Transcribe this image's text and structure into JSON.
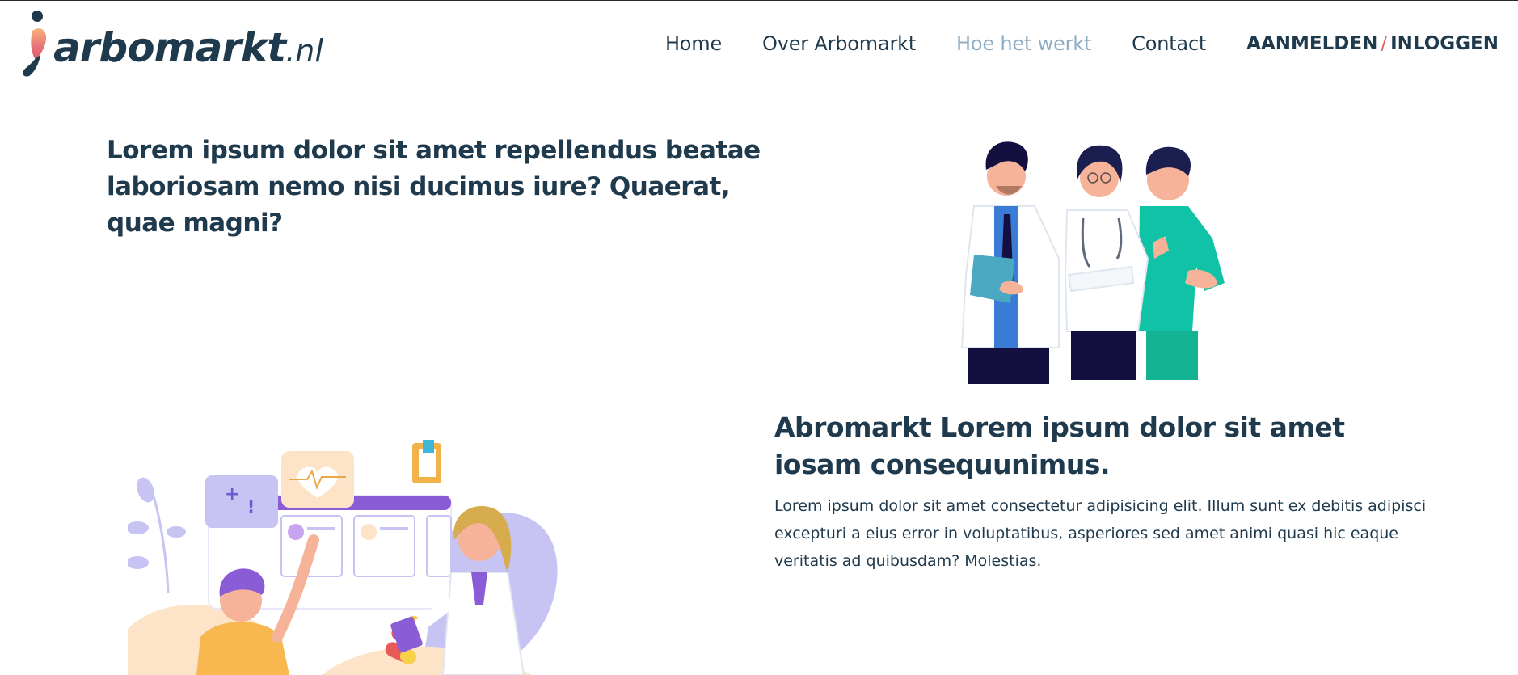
{
  "brand": {
    "name": "arbomarkt",
    "tld": ".nl",
    "colors": {
      "navy": "#1f3a4d",
      "active": "#8eaec4",
      "accent": "#e85a5a"
    }
  },
  "nav": {
    "items": [
      {
        "label": "Home",
        "active": false
      },
      {
        "label": "Over Arbomarkt",
        "active": false
      },
      {
        "label": "Hoe het werkt",
        "active": true
      },
      {
        "label": "Contact",
        "active": false
      }
    ],
    "auth": {
      "register": "AANMELDEN",
      "separator": "/",
      "login": "INLOGGEN"
    }
  },
  "hero": {
    "title": "Lorem ipsum dolor sit amet repellendus beatae laboriosam nemo nisi ducimus iure? Quaerat, quae magni?"
  },
  "section": {
    "title": "Abromarkt Lorem ipsum dolor sit amet iosam consequunimus.",
    "body": "Lorem ipsum dolor sit amet consectetur adipisicing elit. Illum sunt ex debitis adipisci excepturi a eius error in voluptatibus, asperiores sed amet animi quasi hic eaque veritatis ad quibusdam? Molestias."
  },
  "icons": {
    "logo_mark": "person-figure-icon",
    "team": "medical-team-illustration",
    "consult": "doctor-consultation-illustration"
  }
}
